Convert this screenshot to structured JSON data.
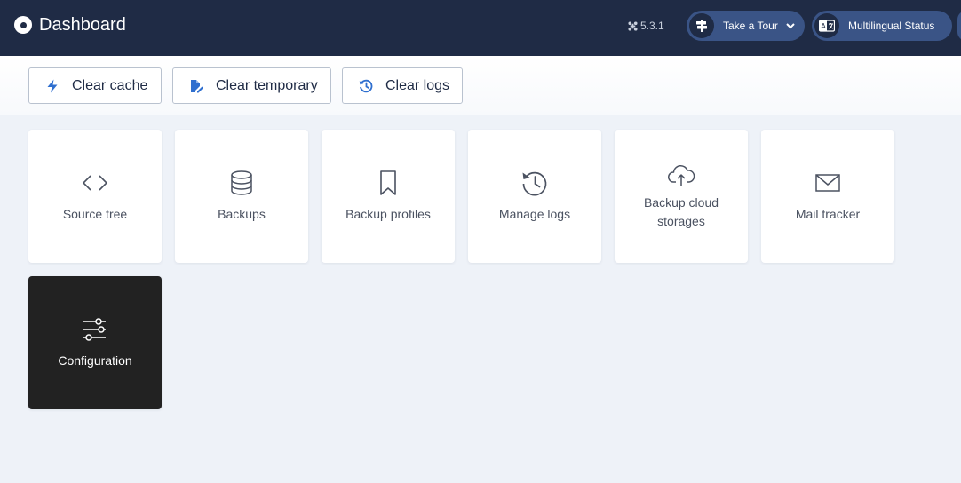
{
  "header": {
    "title": "Dashboard",
    "version": "5.3.1",
    "tour_label": "Take a Tour",
    "multilingual_label": "Multilingual Status"
  },
  "toolbar": {
    "clear_cache": "Clear cache",
    "clear_temporary": "Clear temporary",
    "clear_logs": "Clear logs"
  },
  "tiles": [
    {
      "label": "Source tree",
      "icon": "code-icon"
    },
    {
      "label": "Backups",
      "icon": "database-icon"
    },
    {
      "label": "Backup profiles",
      "icon": "bookmark-icon"
    },
    {
      "label": "Manage logs",
      "icon": "history-icon"
    },
    {
      "label": "Backup cloud storages",
      "icon": "cloud-upload-icon"
    },
    {
      "label": "Mail tracker",
      "icon": "envelope-icon"
    },
    {
      "label": "Configuration",
      "icon": "sliders-icon"
    }
  ],
  "colors": {
    "header_bg": "#1f2b45",
    "pill_bg": "#3a5486",
    "page_bg": "#eef2f8",
    "accent_blue": "#2f6fcf",
    "active_tile_bg": "#222222"
  }
}
